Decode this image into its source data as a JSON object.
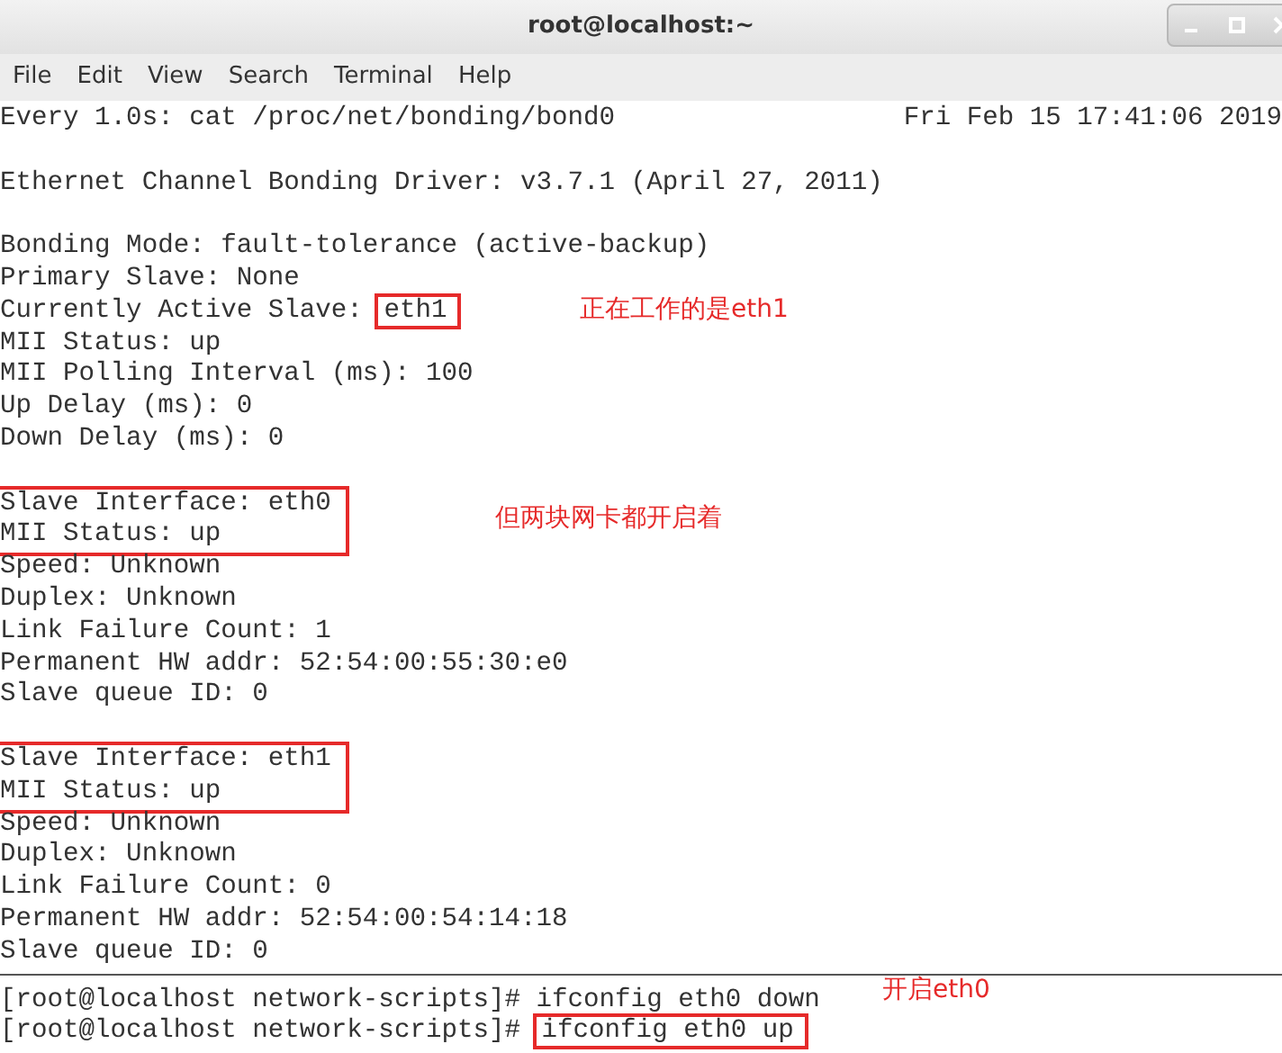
{
  "window": {
    "title": "root@localhost:~"
  },
  "menu": [
    "File",
    "Edit",
    "View",
    "Search",
    "Terminal",
    "Help"
  ],
  "watch_header": {
    "command": "Every 1.0s: cat /proc/net/bonding/bond0",
    "time": "Fri Feb 15 17:41:06 2019"
  },
  "blocks": [
    [
      {
        "text": "Ethernet Channel Bonding Driver: v3.7.1 (April 27, 2011)"
      }
    ],
    [
      {
        "text": "Bonding Mode: fault-tolerance (active-backup)"
      },
      {
        "text": "Primary Slave: None"
      },
      {
        "text": "Currently Active Slave: ",
        "boxed_part": "eth1",
        "note": "正在工作的是eth1"
      },
      {
        "text": "MII Status: up"
      },
      {
        "text": "MII Polling Interval (ms): 100"
      },
      {
        "text": "Up Delay (ms): 0"
      },
      {
        "text": "Down Delay (ms): 0"
      }
    ],
    [
      {
        "text": "Slave Interface: eth0",
        "boxed": true,
        "note": "但两块网卡都开启着"
      },
      {
        "text": "MII Status: up",
        "boxed": true
      },
      {
        "text": "Speed: Unknown"
      },
      {
        "text": "Duplex: Unknown"
      },
      {
        "text": "Link Failure Count: 1"
      },
      {
        "text": "Permanent HW addr: 52:54:00:55:30:e0"
      },
      {
        "text": "Slave queue ID: 0"
      }
    ],
    [
      {
        "text": "Slave Interface: eth1",
        "boxed": true
      },
      {
        "text": "MII Status: up",
        "boxed": true
      },
      {
        "text": "Speed: Unknown"
      },
      {
        "text": "Duplex: Unknown"
      },
      {
        "text": "Link Failure Count: 0"
      },
      {
        "text": "Permanent HW addr: 52:54:00:54:14:18"
      },
      {
        "text": "Slave queue ID: 0"
      }
    ]
  ],
  "prompt_lines": [
    {
      "text": "[root@localhost network-scripts]# ifconfig eth0 down",
      "note": "开启eth0"
    },
    {
      "text": "[root@localhost network-scripts]# ",
      "boxed_part": "ifconfig eth0 up"
    }
  ]
}
